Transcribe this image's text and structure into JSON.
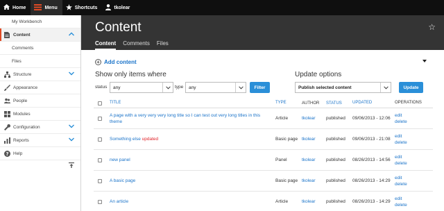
{
  "toolbar": {
    "home": "Home",
    "menu": "Menu",
    "shortcuts": "Shortcuts",
    "user": "tkolear"
  },
  "sidebar": {
    "items": [
      {
        "label": "My Workbench"
      },
      {
        "label": "Content"
      },
      {
        "label": "Comments"
      },
      {
        "label": "Files"
      },
      {
        "label": "Structure"
      },
      {
        "label": "Appearance"
      },
      {
        "label": "People"
      },
      {
        "label": "Modules"
      },
      {
        "label": "Configuration"
      },
      {
        "label": "Reports"
      },
      {
        "label": "Help"
      }
    ]
  },
  "header": {
    "title": "Content",
    "tabs": [
      {
        "label": "Content"
      },
      {
        "label": "Comments"
      },
      {
        "label": "Files"
      }
    ]
  },
  "main": {
    "add_content": "Add content",
    "filter": {
      "heading": "Show only items where",
      "status_label": "status",
      "status_value": "any",
      "type_label": "type",
      "type_value": "any",
      "button": "Filter"
    },
    "update": {
      "heading": "Update options",
      "selected": "Publish selected content",
      "button": "Update"
    },
    "table": {
      "headers": {
        "title": "TITLE",
        "type": "TYPE",
        "author": "AUTHOR",
        "status": "STATUS",
        "updated": "UPDATED",
        "operations": "OPERATIONS"
      },
      "rows": [
        {
          "title": "A page with a very very very long title so I can test out very long titles in this theme",
          "updated_mark": "",
          "type": "Article",
          "author": "tkolear",
          "status": "published",
          "updated": "09/06/2013 - 12:06",
          "edit": "edit",
          "delete": "delete"
        },
        {
          "title": "Something else",
          "updated_mark": "updated",
          "type": "Basic page",
          "author": "tkolear",
          "status": "published",
          "updated": "09/06/2013 - 21:08",
          "edit": "edit",
          "delete": "delete"
        },
        {
          "title": "new panel",
          "updated_mark": "",
          "type": "Panel",
          "author": "tkolear",
          "status": "published",
          "updated": "08/26/2013 - 14:56",
          "edit": "edit",
          "delete": "delete"
        },
        {
          "title": "A basic page",
          "updated_mark": "",
          "type": "Basic page",
          "author": "tkolear",
          "status": "published",
          "updated": "08/26/2013 - 14:29",
          "edit": "edit",
          "delete": "delete"
        },
        {
          "title": "An article",
          "updated_mark": "",
          "type": "Article",
          "author": "tkolear",
          "status": "published",
          "updated": "08/26/2013 - 14:29",
          "edit": "edit",
          "delete": "delete"
        }
      ]
    }
  },
  "colors": {
    "accent_link": "#1a73c9",
    "button": "#2a8fd8",
    "toolbar": "#0f0f0f",
    "header": "#343434",
    "active_marker": "#e04a24",
    "updated_mark": "#e0242b"
  },
  "icons": [
    "home-icon",
    "menu-icon",
    "star-icon",
    "user-icon",
    "content-icon",
    "structure-icon",
    "appearance-icon",
    "people-icon",
    "modules-icon",
    "configuration-icon",
    "reports-icon",
    "help-icon",
    "chevron-down-icon",
    "chevron-up-icon",
    "collapse-icon",
    "plus-circle-icon"
  ]
}
